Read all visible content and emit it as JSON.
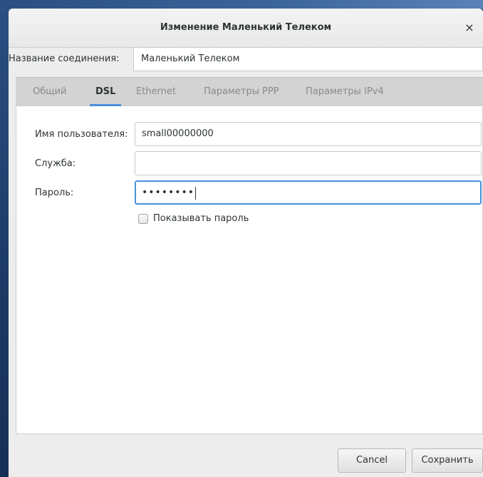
{
  "window": {
    "title": "Изменение Маленький Телеком",
    "close_glyph": "×"
  },
  "connection": {
    "label": "Название соединения:",
    "name_value": "Маленький Телеком"
  },
  "tabs": [
    {
      "label": "Общий",
      "active": false
    },
    {
      "label": "DSL",
      "active": true
    },
    {
      "label": "Ethernet",
      "active": false
    },
    {
      "label": "Параметры PPP",
      "active": false
    },
    {
      "label": "Параметры IPv4",
      "active": false
    }
  ],
  "dsl": {
    "username_label": "Имя пользователя:",
    "username_value": "small00000000",
    "service_label": "Служба:",
    "service_value": "",
    "password_label": "Пароль:",
    "password_masked": "••••••••",
    "show_password_label": "Показывать пароль",
    "show_password_checked": false
  },
  "buttons": {
    "cancel": "Cancel",
    "save": "Сохранить"
  },
  "colors": {
    "accent": "#4a90d9",
    "background": "#ededed",
    "tabbar": "#d3d3d3"
  }
}
